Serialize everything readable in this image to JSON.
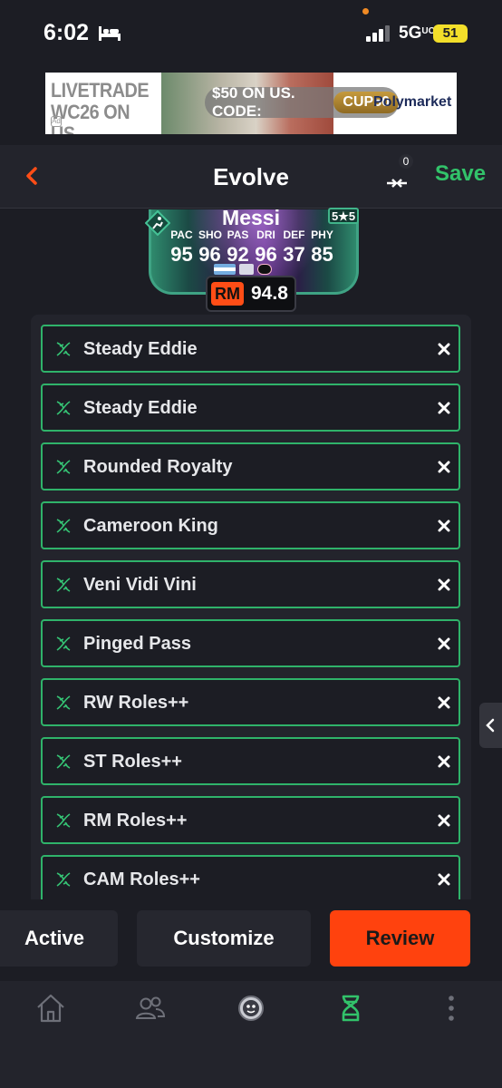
{
  "status_bar": {
    "time": "6:02",
    "network": "5G",
    "network_suffix": "UC",
    "battery": "51"
  },
  "ad": {
    "headline": "LIVETRADE WC26 ON US",
    "offer": "$50 ON US. CODE:",
    "code": "CUP50",
    "brand": "Polymarket",
    "badge": "Ad"
  },
  "header": {
    "title": "Evolve",
    "compare_count": "0",
    "save_label": "Save"
  },
  "card": {
    "name": "Messi",
    "skill_rating": "5★5",
    "stat_labels": [
      "PAC",
      "SHO",
      "PAS",
      "DRI",
      "DEF",
      "PHY"
    ],
    "stat_values": [
      "95",
      "96",
      "92",
      "96",
      "37",
      "85"
    ],
    "position": "RM",
    "rating": "94.8"
  },
  "evolutions": [
    "Steady Eddie",
    "Steady Eddie",
    "Rounded Royalty",
    "Cameroon King",
    "Veni Vidi Vini",
    "Pinged Pass",
    "RW Roles++",
    "ST Roles++",
    "RM Roles++",
    "CAM Roles++"
  ],
  "actions": {
    "active": "Active",
    "customize": "Customize",
    "review": "Review"
  },
  "tabs": [
    "home-icon",
    "friends-icon",
    "club-icon",
    "evolution-icon",
    "more-icon"
  ],
  "colors": {
    "accent_green": "#32c36a",
    "accent_orange": "#ff420e",
    "background": "#1c1d24"
  }
}
